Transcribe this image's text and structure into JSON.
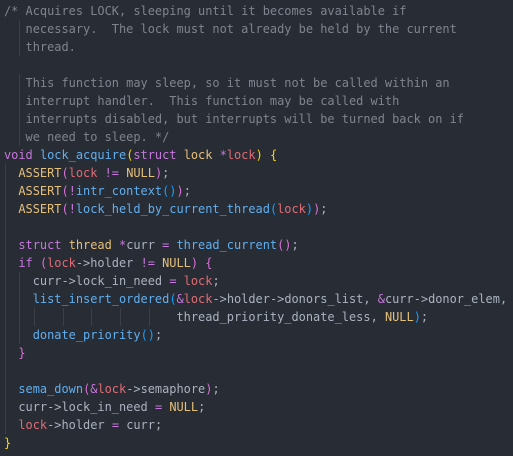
{
  "editor": {
    "language": "c",
    "theme_background": "#282c34",
    "token_colors": {
      "comment": "#7f848e",
      "keyword": "#c678dd",
      "type": "#e5c07b",
      "function": "#61afef",
      "variable": "#e06c75",
      "operator": "#56b6c2",
      "plain": "#abb2bf"
    },
    "lines": [
      [
        {
          "t": "/* Acquires LOCK, sleeping until it becomes available if",
          "c": "comment"
        }
      ],
      [
        {
          "t": "   necessary.  The lock must not already be held by the current",
          "c": "comment"
        }
      ],
      [
        {
          "t": "   thread.",
          "c": "comment"
        }
      ],
      [
        {
          "t": "",
          "c": "plain"
        }
      ],
      [
        {
          "t": "   This function may sleep, so it must not be called within an",
          "c": "comment"
        }
      ],
      [
        {
          "t": "   interrupt handler.  This function may be called with",
          "c": "comment"
        }
      ],
      [
        {
          "t": "   interrupts disabled, but interrupts will be turned back on if",
          "c": "comment"
        }
      ],
      [
        {
          "t": "   we need to sleep. */",
          "c": "comment"
        }
      ],
      [
        {
          "t": "void",
          "c": "kw"
        },
        {
          "t": " ",
          "c": "plain"
        },
        {
          "t": "lock_acquire",
          "c": "fn"
        },
        {
          "t": "(",
          "c": "brace-1"
        },
        {
          "t": "struct",
          "c": "kw"
        },
        {
          "t": " ",
          "c": "plain"
        },
        {
          "t": "lock",
          "c": "type"
        },
        {
          "t": " ",
          "c": "plain"
        },
        {
          "t": "*",
          "c": "kw"
        },
        {
          "t": "lock",
          "c": "var"
        },
        {
          "t": ")",
          "c": "brace-1"
        },
        {
          "t": " ",
          "c": "plain"
        },
        {
          "t": "{",
          "c": "brace-1"
        }
      ],
      [
        {
          "t": "  ",
          "c": "plain"
        },
        {
          "t": "ASSERT",
          "c": "macro"
        },
        {
          "t": "(",
          "c": "brace-2"
        },
        {
          "t": "lock",
          "c": "var"
        },
        {
          "t": " ",
          "c": "plain"
        },
        {
          "t": "!=",
          "c": "kw"
        },
        {
          "t": " ",
          "c": "plain"
        },
        {
          "t": "NULL",
          "c": "macro"
        },
        {
          "t": ")",
          "c": "brace-2"
        },
        {
          "t": ";",
          "c": "plain"
        }
      ],
      [
        {
          "t": "  ",
          "c": "plain"
        },
        {
          "t": "ASSERT",
          "c": "macro"
        },
        {
          "t": "(",
          "c": "brace-2"
        },
        {
          "t": "!",
          "c": "kw"
        },
        {
          "t": "intr_context",
          "c": "fn"
        },
        {
          "t": "()",
          "c": "brace-3"
        },
        {
          "t": ")",
          "c": "brace-2"
        },
        {
          "t": ";",
          "c": "plain"
        }
      ],
      [
        {
          "t": "  ",
          "c": "plain"
        },
        {
          "t": "ASSERT",
          "c": "macro"
        },
        {
          "t": "(",
          "c": "brace-2"
        },
        {
          "t": "!",
          "c": "kw"
        },
        {
          "t": "lock_held_by_current_thread",
          "c": "fn"
        },
        {
          "t": "(",
          "c": "brace-3"
        },
        {
          "t": "lock",
          "c": "var"
        },
        {
          "t": ")",
          "c": "brace-3"
        },
        {
          "t": ")",
          "c": "brace-2"
        },
        {
          "t": ";",
          "c": "plain"
        }
      ],
      [
        {
          "t": "",
          "c": "plain"
        }
      ],
      [
        {
          "t": "  ",
          "c": "plain"
        },
        {
          "t": "struct",
          "c": "kw"
        },
        {
          "t": " ",
          "c": "plain"
        },
        {
          "t": "thread",
          "c": "type"
        },
        {
          "t": " ",
          "c": "plain"
        },
        {
          "t": "*",
          "c": "kw"
        },
        {
          "t": "curr",
          "c": "plain"
        },
        {
          "t": " ",
          "c": "plain"
        },
        {
          "t": "=",
          "c": "kw"
        },
        {
          "t": " ",
          "c": "plain"
        },
        {
          "t": "thread_current",
          "c": "fn"
        },
        {
          "t": "()",
          "c": "brace-2"
        },
        {
          "t": ";",
          "c": "plain"
        }
      ],
      [
        {
          "t": "  ",
          "c": "plain"
        },
        {
          "t": "if",
          "c": "kw"
        },
        {
          "t": " ",
          "c": "plain"
        },
        {
          "t": "(",
          "c": "brace-2"
        },
        {
          "t": "lock",
          "c": "var"
        },
        {
          "t": "->",
          "c": "plain"
        },
        {
          "t": "holder",
          "c": "plain"
        },
        {
          "t": " ",
          "c": "plain"
        },
        {
          "t": "!=",
          "c": "kw"
        },
        {
          "t": " ",
          "c": "plain"
        },
        {
          "t": "NULL",
          "c": "macro"
        },
        {
          "t": ")",
          "c": "brace-2"
        },
        {
          "t": " ",
          "c": "plain"
        },
        {
          "t": "{",
          "c": "brace-2"
        }
      ],
      [
        {
          "t": "    ",
          "c": "plain"
        },
        {
          "t": "curr",
          "c": "plain"
        },
        {
          "t": "->",
          "c": "plain"
        },
        {
          "t": "lock_in_need",
          "c": "plain"
        },
        {
          "t": " ",
          "c": "plain"
        },
        {
          "t": "=",
          "c": "kw"
        },
        {
          "t": " ",
          "c": "plain"
        },
        {
          "t": "lock",
          "c": "var"
        },
        {
          "t": ";",
          "c": "plain"
        }
      ],
      [
        {
          "t": "    ",
          "c": "plain"
        },
        {
          "t": "list_insert_ordered",
          "c": "fn"
        },
        {
          "t": "(",
          "c": "brace-3"
        },
        {
          "t": "&",
          "c": "kw"
        },
        {
          "t": "lock",
          "c": "var"
        },
        {
          "t": "->",
          "c": "plain"
        },
        {
          "t": "holder",
          "c": "plain"
        },
        {
          "t": "->",
          "c": "plain"
        },
        {
          "t": "donors_list",
          "c": "plain"
        },
        {
          "t": ", ",
          "c": "plain"
        },
        {
          "t": "&",
          "c": "kw"
        },
        {
          "t": "curr",
          "c": "plain"
        },
        {
          "t": "->",
          "c": "plain"
        },
        {
          "t": "donor_elem",
          "c": "plain"
        },
        {
          "t": ",",
          "c": "plain"
        }
      ],
      [
        {
          "t": "                        ",
          "c": "plain"
        },
        {
          "t": "thread_priority_donate_less",
          "c": "plain"
        },
        {
          "t": ", ",
          "c": "plain"
        },
        {
          "t": "NULL",
          "c": "macro"
        },
        {
          "t": ")",
          "c": "brace-3"
        },
        {
          "t": ";",
          "c": "plain"
        }
      ],
      [
        {
          "t": "    ",
          "c": "plain"
        },
        {
          "t": "donate_priority",
          "c": "fn"
        },
        {
          "t": "()",
          "c": "brace-3"
        },
        {
          "t": ";",
          "c": "plain"
        }
      ],
      [
        {
          "t": "  ",
          "c": "plain"
        },
        {
          "t": "}",
          "c": "brace-2"
        }
      ],
      [
        {
          "t": "",
          "c": "plain"
        }
      ],
      [
        {
          "t": "  ",
          "c": "plain"
        },
        {
          "t": "sema_down",
          "c": "fn"
        },
        {
          "t": "(",
          "c": "brace-2"
        },
        {
          "t": "&",
          "c": "kw"
        },
        {
          "t": "lock",
          "c": "var"
        },
        {
          "t": "->",
          "c": "plain"
        },
        {
          "t": "semaphore",
          "c": "plain"
        },
        {
          "t": ")",
          "c": "brace-2"
        },
        {
          "t": ";",
          "c": "plain"
        }
      ],
      [
        {
          "t": "  ",
          "c": "plain"
        },
        {
          "t": "curr",
          "c": "plain"
        },
        {
          "t": "->",
          "c": "plain"
        },
        {
          "t": "lock_in_need",
          "c": "plain"
        },
        {
          "t": " ",
          "c": "plain"
        },
        {
          "t": "=",
          "c": "kw"
        },
        {
          "t": " ",
          "c": "plain"
        },
        {
          "t": "NULL",
          "c": "macro"
        },
        {
          "t": ";",
          "c": "plain"
        }
      ],
      [
        {
          "t": "  ",
          "c": "plain"
        },
        {
          "t": "lock",
          "c": "var"
        },
        {
          "t": "->",
          "c": "plain"
        },
        {
          "t": "holder",
          "c": "plain"
        },
        {
          "t": " ",
          "c": "plain"
        },
        {
          "t": "=",
          "c": "kw"
        },
        {
          "t": " ",
          "c": "plain"
        },
        {
          "t": "curr",
          "c": "plain"
        },
        {
          "t": ";",
          "c": "plain"
        }
      ],
      [
        {
          "t": "}",
          "c": "brace-1"
        }
      ]
    ]
  }
}
